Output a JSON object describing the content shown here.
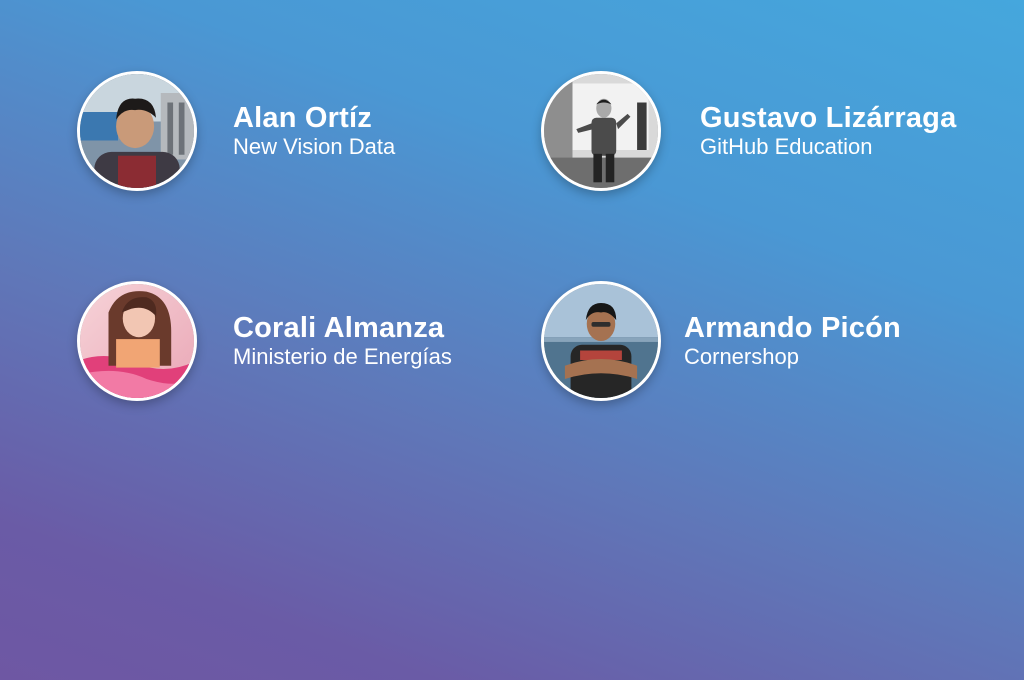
{
  "speakers": [
    {
      "name": "Alan Ortíz",
      "org": "New Vision Data"
    },
    {
      "name": "Gustavo Lizárraga",
      "org": "GitHub Education"
    },
    {
      "name": "Corali Almanza",
      "org": "Ministerio de Energías"
    },
    {
      "name": "Armando Picón",
      "org": "Cornershop"
    }
  ]
}
